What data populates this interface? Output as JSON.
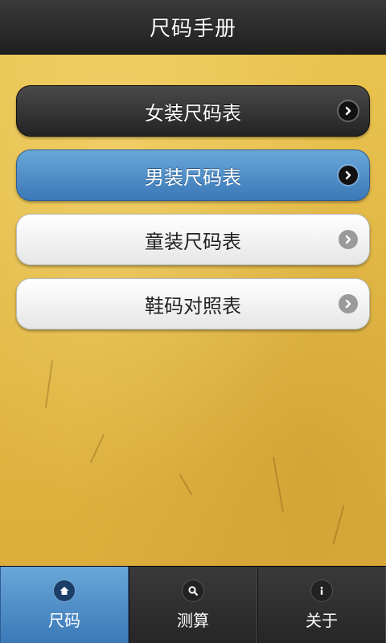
{
  "header": {
    "title": "尺码手册"
  },
  "menu": {
    "items": [
      {
        "label": "女装尺码表",
        "style": "dark"
      },
      {
        "label": "男装尺码表",
        "style": "blue"
      },
      {
        "label": "童装尺码表",
        "style": "light"
      },
      {
        "label": "鞋码对照表",
        "style": "light"
      }
    ]
  },
  "tabs": [
    {
      "label": "尺码",
      "icon": "home-icon",
      "active": true
    },
    {
      "label": "测算",
      "icon": "search-icon",
      "active": false
    },
    {
      "label": "关于",
      "icon": "info-icon",
      "active": false
    }
  ],
  "colors": {
    "background": "#e2b844",
    "header": "#262626",
    "accent_blue": "#4a88c6",
    "light_button": "#f2f2f2"
  }
}
